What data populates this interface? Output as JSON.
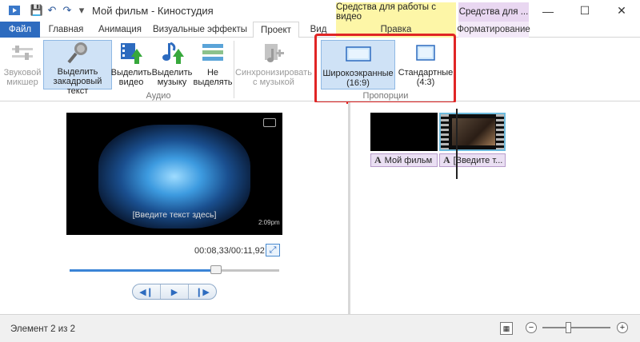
{
  "window": {
    "title": "Мой фильм - Киностудия",
    "contextual_video": "Средства для работы с видео",
    "contextual_text": "Средства для ...",
    "minimize": "—",
    "maximize": "☐",
    "close": "✕"
  },
  "quick_access": {
    "save": "💾",
    "undo": "↶",
    "redo": "↷",
    "dropdown": "▾"
  },
  "tabs": [
    {
      "label": "Файл"
    },
    {
      "label": "Главная"
    },
    {
      "label": "Анимация"
    },
    {
      "label": "Визуальные эффекты"
    },
    {
      "label": "Проект"
    },
    {
      "label": "Вид"
    },
    {
      "label": "Правка"
    },
    {
      "label": "Форматирование"
    }
  ],
  "ribbon": {
    "audio_group_label": "Аудио",
    "proportions_group_label": "Пропорции",
    "buttons": {
      "sound_mixer": {
        "line1": "Звуковой",
        "line2": "микшер"
      },
      "emphasize_narration": {
        "line1": "Выделить",
        "line2": "закадровый текст"
      },
      "emphasize_video": {
        "line1": "Выделить",
        "line2": "видео"
      },
      "emphasize_music": {
        "line1": "Выделить",
        "line2": "музыку"
      },
      "no_emphasis": {
        "line1": "Не",
        "line2": "выделять"
      },
      "sync_music": {
        "line1": "Синхронизировать",
        "line2": "с музыкой"
      },
      "widescreen": {
        "line1": "Широкоэкранные",
        "line2": "(16:9)"
      },
      "standard": {
        "line1": "Стандартные",
        "line2": "(4:3)"
      }
    }
  },
  "preview": {
    "caption": "[Введите текст здесь]",
    "badge": "2:09pm",
    "time": "00:08,33/00:11,92",
    "position": 0.699,
    "controls": {
      "prev": "◀❙",
      "play": "▶",
      "next": "❙▶"
    }
  },
  "storyboard": {
    "captions": [
      "Мой фильм",
      "[Введите т..."
    ],
    "caption_glyph": "A"
  },
  "status": {
    "text": "Элемент 2 из 2",
    "zoom_out": "−",
    "zoom_in": "+",
    "zoom_level": 0.38
  },
  "colors": {
    "accent": "#2d6bbf",
    "highlight": "#e02525",
    "contextual_video": "#fdf6a7",
    "contextual_text": "#e9d7f1"
  }
}
